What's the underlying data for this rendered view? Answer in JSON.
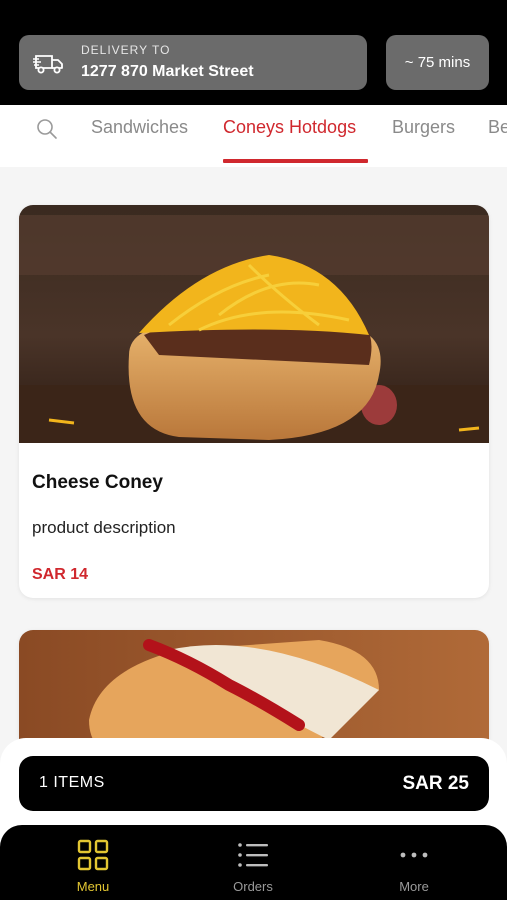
{
  "header": {
    "delivery_label": "DELIVERY TO",
    "address": "1277 870 Market Street",
    "eta": "~ 75 mins",
    "icon": "delivery-truck-icon"
  },
  "tabs": [
    {
      "label": "Sandwiches",
      "active": false
    },
    {
      "label": "Coneys Hotdogs",
      "active": true
    },
    {
      "label": "Burgers",
      "active": false
    },
    {
      "label": "Be",
      "active": false
    }
  ],
  "products": [
    {
      "name": "Cheese Coney",
      "description": "product description",
      "price": "SAR 14"
    }
  ],
  "cart": {
    "count_label": "1 ITEMS",
    "total": "SAR 25"
  },
  "nav": [
    {
      "label": "Menu",
      "icon": "grid-icon",
      "active": true
    },
    {
      "label": "Orders",
      "icon": "list-icon",
      "active": false
    },
    {
      "label": "More",
      "icon": "more-icon",
      "active": false
    }
  ],
  "colors": {
    "accent": "#d0282e",
    "nav_active": "#e2c632",
    "header_bg": "#000000",
    "card_bg": "#ffffff"
  }
}
